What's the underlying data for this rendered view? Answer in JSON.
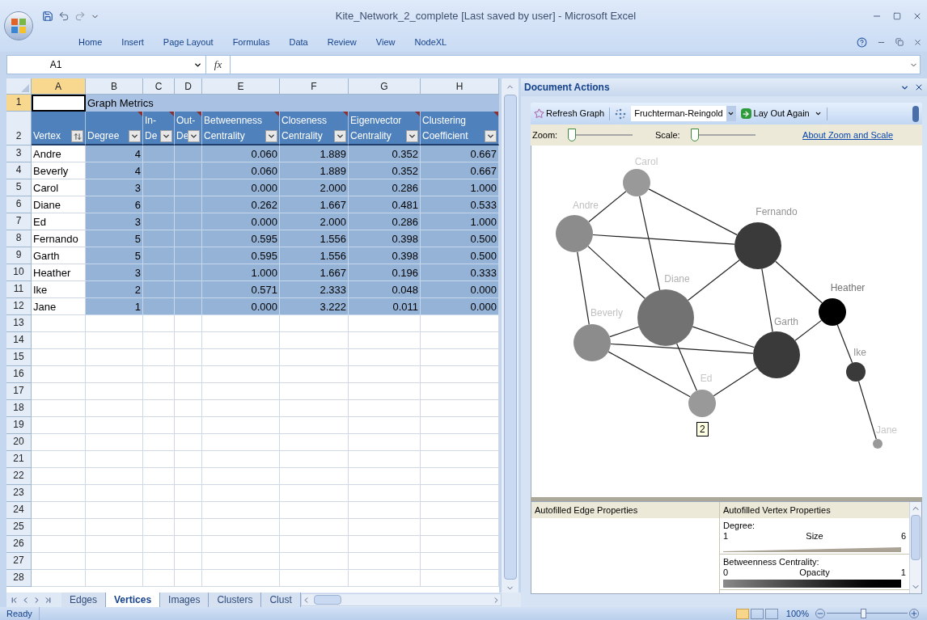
{
  "window": {
    "title": "Kite_Network_2_complete [Last saved by user] - Microsoft Excel"
  },
  "ribbon_tabs": [
    "Home",
    "Insert",
    "Page Layout",
    "Formulas",
    "Data",
    "Review",
    "View",
    "NodeXL"
  ],
  "formula_bar": {
    "name_box": "A1",
    "function_label": "fx"
  },
  "sheet": {
    "columns": [
      {
        "label": "A",
        "selected": true
      },
      {
        "label": "B",
        "selected": false
      },
      {
        "label": "C",
        "selected": false
      },
      {
        "label": "D",
        "selected": false
      },
      {
        "label": "E",
        "selected": false
      },
      {
        "label": "F",
        "selected": false
      },
      {
        "label": "G",
        "selected": false
      },
      {
        "label": "H",
        "selected": false
      }
    ],
    "title_row": {
      "number": "1",
      "selected": true,
      "text": "Graph Metrics"
    },
    "header_row": {
      "number": "2",
      "selected": false,
      "headers": [
        {
          "lines": [
            "Vertex"
          ],
          "kind": "sorted",
          "comment": false
        },
        {
          "lines": [
            "Degree"
          ],
          "kind": "filter",
          "comment": true
        },
        {
          "lines": [
            "In-",
            "De"
          ],
          "kind": "filter",
          "comment": true
        },
        {
          "lines": [
            "Out-",
            "De"
          ],
          "kind": "filter",
          "comment": true
        },
        {
          "lines": [
            "Betweenness",
            "Centrality"
          ],
          "kind": "filter",
          "comment": true
        },
        {
          "lines": [
            "Closeness",
            "Centrality"
          ],
          "kind": "filter",
          "comment": true
        },
        {
          "lines": [
            "Eigenvector",
            "Centrality"
          ],
          "kind": "filter",
          "comment": true
        },
        {
          "lines": [
            "Clustering",
            "Coefficient"
          ],
          "kind": "filter",
          "comment": true
        }
      ]
    },
    "rows": [
      {
        "number": "3",
        "vertex": "Andre",
        "degree": "4",
        "betweenness": "0.060",
        "closeness": "1.889",
        "eigenvector": "0.352",
        "clustering": "0.667"
      },
      {
        "number": "4",
        "vertex": "Beverly",
        "degree": "4",
        "betweenness": "0.060",
        "closeness": "1.889",
        "eigenvector": "0.352",
        "clustering": "0.667"
      },
      {
        "number": "5",
        "vertex": "Carol",
        "degree": "3",
        "betweenness": "0.000",
        "closeness": "2.000",
        "eigenvector": "0.286",
        "clustering": "1.000"
      },
      {
        "number": "6",
        "vertex": "Diane",
        "degree": "6",
        "betweenness": "0.262",
        "closeness": "1.667",
        "eigenvector": "0.481",
        "clustering": "0.533"
      },
      {
        "number": "7",
        "vertex": "Ed",
        "degree": "3",
        "betweenness": "0.000",
        "closeness": "2.000",
        "eigenvector": "0.286",
        "clustering": "1.000"
      },
      {
        "number": "8",
        "vertex": "Fernando",
        "degree": "5",
        "betweenness": "0.595",
        "closeness": "1.556",
        "eigenvector": "0.398",
        "clustering": "0.500"
      },
      {
        "number": "9",
        "vertex": "Garth",
        "degree": "5",
        "betweenness": "0.595",
        "closeness": "1.556",
        "eigenvector": "0.398",
        "clustering": "0.500"
      },
      {
        "number": "10",
        "vertex": "Heather",
        "degree": "3",
        "betweenness": "1.000",
        "closeness": "1.667",
        "eigenvector": "0.196",
        "clustering": "0.333"
      },
      {
        "number": "11",
        "vertex": "Ike",
        "degree": "2",
        "betweenness": "0.571",
        "closeness": "2.333",
        "eigenvector": "0.048",
        "clustering": "0.000"
      },
      {
        "number": "12",
        "vertex": "Jane",
        "degree": "1",
        "betweenness": "0.000",
        "closeness": "3.222",
        "eigenvector": "0.011",
        "clustering": "0.000"
      }
    ],
    "empty_rows": [
      "13",
      "14",
      "15",
      "16",
      "17",
      "18",
      "19",
      "20",
      "21",
      "22",
      "23",
      "24",
      "25",
      "26",
      "27",
      "28"
    ]
  },
  "sheet_tabs": [
    {
      "label": "Edges",
      "selected": false
    },
    {
      "label": "Vertices",
      "selected": true
    },
    {
      "label": "Images",
      "selected": false
    },
    {
      "label": "Clusters",
      "selected": false
    },
    {
      "label": "Clust",
      "selected": false
    }
  ],
  "document_actions": {
    "title": "Document Actions",
    "toolbar": {
      "refresh": "Refresh Graph",
      "layout": "Fruchterman-Reingold",
      "lay_out_again": "Lay Out Again"
    },
    "zoom": {
      "label": "Zoom:",
      "level": 0
    },
    "scale": {
      "label": "Scale:",
      "level": 0
    },
    "link": "About Zoom and Scale",
    "graph": {
      "nodes": [
        {
          "label": "Andre",
          "color": "#8c8c8c"
        },
        {
          "label": "Beverly",
          "color": "#8c8c8c"
        },
        {
          "label": "Carol",
          "color": "#999999"
        },
        {
          "label": "Diane",
          "color": "#727272"
        },
        {
          "label": "Ed",
          "color": "#999999"
        },
        {
          "label": "Fernando",
          "color": "#3a3a3a"
        },
        {
          "label": "Garth",
          "color": "#3a3a3a"
        },
        {
          "label": "Heather",
          "color": "#000000"
        },
        {
          "label": "Ike",
          "color": "#3a3a3a"
        },
        {
          "label": "Jane",
          "color": "#999999"
        }
      ],
      "tooltip": "2"
    },
    "autofill": {
      "edge_title": "Autofilled Edge Properties",
      "vertex_title": "Autofilled Vertex Properties",
      "items": [
        {
          "metric": "Degree:",
          "min": "1",
          "property": "Size",
          "max": "6",
          "kind": "size"
        },
        {
          "metric": "Betweenness Centrality:",
          "min": "0",
          "property": "Opacity",
          "max": "1",
          "kind": "opacity"
        }
      ]
    }
  },
  "status_bar": {
    "text": "Ready",
    "zoom": "100%",
    "zoom_slider": {
      "level": 0.45
    }
  }
}
